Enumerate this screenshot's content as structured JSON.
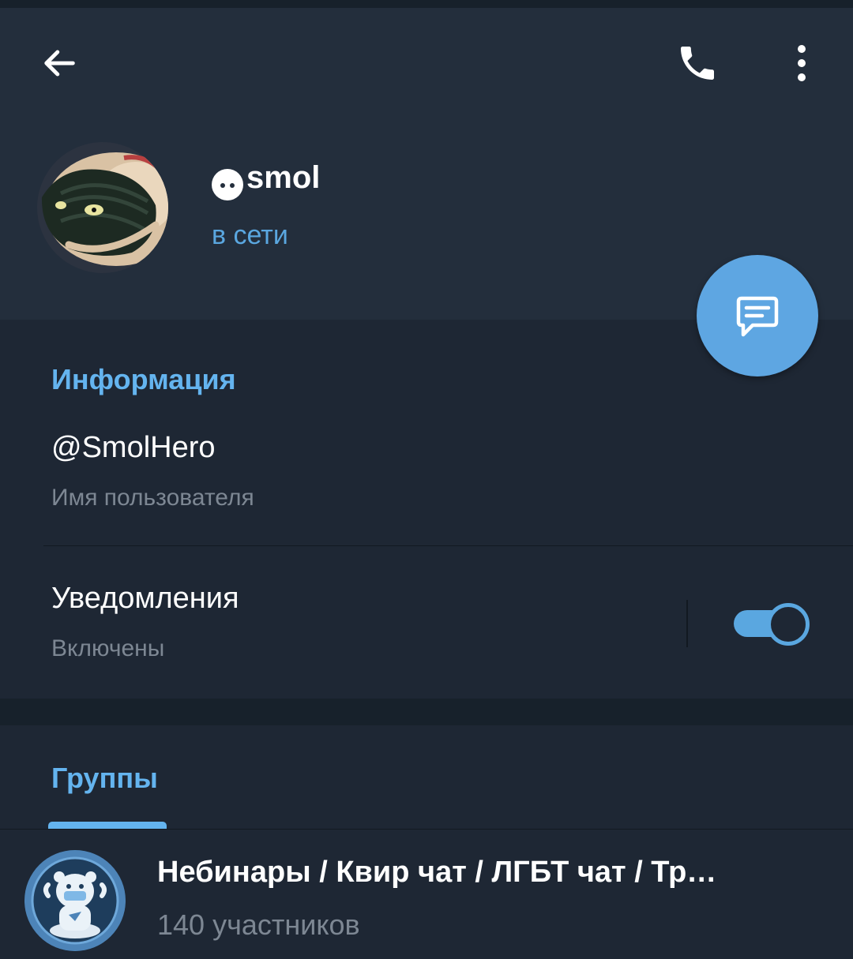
{
  "header": {
    "title": "smol",
    "status": "в сети",
    "icons": {
      "back": "arrow-left-icon",
      "call": "phone-icon",
      "more": "more-vertical-icon",
      "fab": "message-icon"
    }
  },
  "info": {
    "section_title": "Информация",
    "username": "@SmolHero",
    "username_caption": "Имя пользователя",
    "notifications_label": "Уведомления",
    "notifications_status": "Включены",
    "notifications_enabled": true
  },
  "groups": {
    "tab_label": "Группы",
    "items": [
      {
        "name": "Небинары / Квир чат / ЛГБТ чат / Тр…",
        "members": "140 участников"
      }
    ]
  },
  "colors": {
    "accent": "#5aa7e0",
    "header_bg": "#232e3c",
    "section_bg": "#1e2734",
    "page_bg": "#17212b"
  }
}
